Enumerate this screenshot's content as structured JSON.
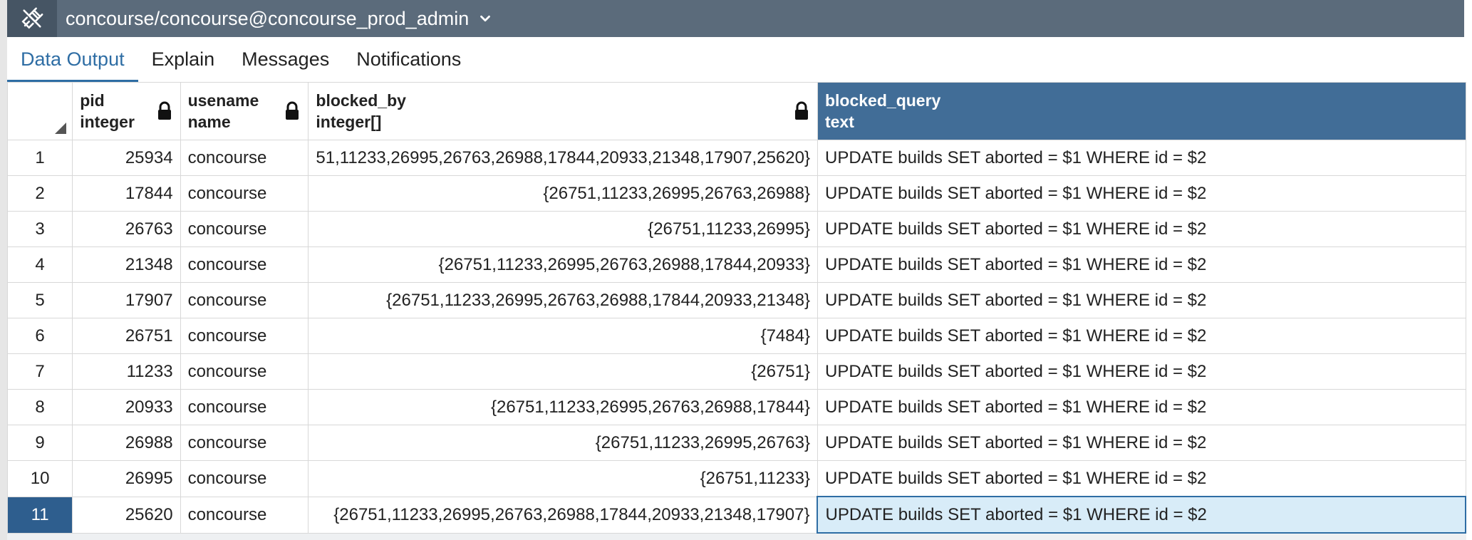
{
  "connection": {
    "title": "concourse/concourse@concourse_prod_admin",
    "icon": "plug-disconnect-icon"
  },
  "tabs": [
    {
      "label": "Data Output",
      "active": true
    },
    {
      "label": "Explain",
      "active": false
    },
    {
      "label": "Messages",
      "active": false
    },
    {
      "label": "Notifications",
      "active": false
    }
  ],
  "columns": [
    {
      "name": "pid",
      "type": "integer",
      "locked": true
    },
    {
      "name": "usename",
      "type": "name",
      "locked": true
    },
    {
      "name": "blocked_by",
      "type": "integer[]",
      "locked": true
    },
    {
      "name": "blocked_query",
      "type": "text",
      "locked": false,
      "selected": true
    }
  ],
  "rows": [
    {
      "num": "1",
      "pid": "25934",
      "usename": "concourse",
      "blocked_by": "51,11233,26995,26763,26988,17844,20933,21348,17907,25620}",
      "blocked_query": "UPDATE builds SET aborted = $1 WHERE id = $2"
    },
    {
      "num": "2",
      "pid": "17844",
      "usename": "concourse",
      "blocked_by": "{26751,11233,26995,26763,26988}",
      "blocked_query": "UPDATE builds SET aborted = $1 WHERE id = $2"
    },
    {
      "num": "3",
      "pid": "26763",
      "usename": "concourse",
      "blocked_by": "{26751,11233,26995}",
      "blocked_query": "UPDATE builds SET aborted = $1 WHERE id = $2"
    },
    {
      "num": "4",
      "pid": "21348",
      "usename": "concourse",
      "blocked_by": "{26751,11233,26995,26763,26988,17844,20933}",
      "blocked_query": "UPDATE builds SET aborted = $1 WHERE id = $2"
    },
    {
      "num": "5",
      "pid": "17907",
      "usename": "concourse",
      "blocked_by": "{26751,11233,26995,26763,26988,17844,20933,21348}",
      "blocked_query": "UPDATE builds SET aborted = $1 WHERE id = $2"
    },
    {
      "num": "6",
      "pid": "26751",
      "usename": "concourse",
      "blocked_by": "{7484}",
      "blocked_query": "UPDATE builds SET aborted = $1 WHERE id = $2"
    },
    {
      "num": "7",
      "pid": "11233",
      "usename": "concourse",
      "blocked_by": "{26751}",
      "blocked_query": "UPDATE builds SET aborted = $1 WHERE id = $2"
    },
    {
      "num": "8",
      "pid": "20933",
      "usename": "concourse",
      "blocked_by": "{26751,11233,26995,26763,26988,17844}",
      "blocked_query": "UPDATE builds SET aborted = $1 WHERE id = $2"
    },
    {
      "num": "9",
      "pid": "26988",
      "usename": "concourse",
      "blocked_by": "{26751,11233,26995,26763}",
      "blocked_query": "UPDATE builds SET aborted = $1 WHERE id = $2"
    },
    {
      "num": "10",
      "pid": "26995",
      "usename": "concourse",
      "blocked_by": "{26751,11233}",
      "blocked_query": "UPDATE builds SET aborted = $1 WHERE id = $2"
    },
    {
      "num": "11",
      "pid": "25620",
      "usename": "concourse",
      "blocked_by": "{26751,11233,26995,26763,26988,17844,20933,21348,17907}",
      "blocked_query": "UPDATE builds SET aborted = $1 WHERE id = $2",
      "selected": true
    }
  ],
  "colors": {
    "header_bar": "#5b6b7b",
    "accent": "#2e6da4",
    "selected_column": "#416d97"
  }
}
